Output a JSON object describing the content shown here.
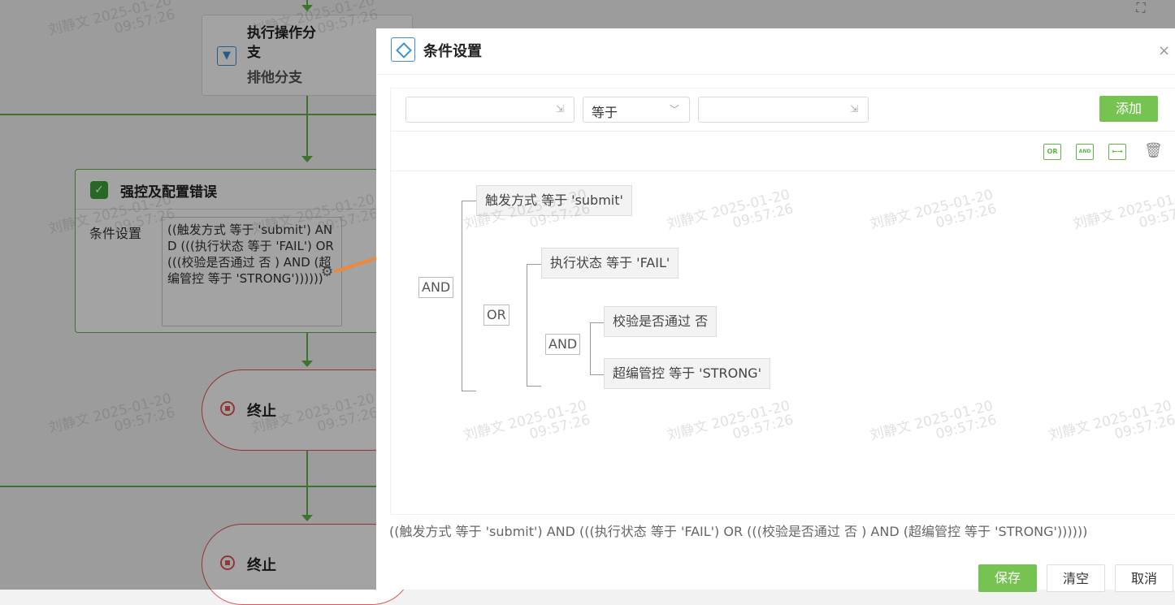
{
  "flow": {
    "branch_node": {
      "title": "执行操作分支",
      "subtitle": "排他分支"
    },
    "condition_node": {
      "title": "强控及配置错误",
      "field_label": "条件设置",
      "condition_text": "((触发方式 等于 'submit') AND (((执行状态 等于 'FAIL') OR (((校验是否通过 否 ) AND (超编管控 等于 'STRONG'))))))"
    },
    "end_nodes": [
      {
        "label": "终止"
      },
      {
        "label": "终止"
      }
    ]
  },
  "watermark": {
    "name": "刘静文",
    "date": "2025-01-20",
    "time": "09:57:26"
  },
  "dialog": {
    "title": "条件设置",
    "close_symbol": "×",
    "toolbar": {
      "left_placeholder": "",
      "operator": "等于",
      "right_placeholder": "",
      "add_label": "添加"
    },
    "tool_icons": [
      {
        "name": "or-icon",
        "label": "OR"
      },
      {
        "name": "and-icon",
        "label": "AND"
      },
      {
        "name": "swap-icon",
        "label": "←→"
      }
    ],
    "tree": {
      "root_op": "AND",
      "level2_op": "OR",
      "level3_op": "AND",
      "leaves": [
        "触发方式 等于 'submit'",
        "执行状态 等于 'FAIL'",
        "校验是否通过 否",
        "超编管控 等于 'STRONG'"
      ]
    },
    "summary": "((触发方式 等于 'submit') AND (((执行状态 等于 'FAIL') OR (((校验是否通过 否 ) AND (超编管控 等于 'STRONG'))))))",
    "buttons": {
      "save": "保存",
      "clear": "清空",
      "cancel": "取消"
    }
  },
  "colors": {
    "accent_green": "#77c351",
    "flow_green": "#63b34a",
    "end_red": "#e05757",
    "icon_blue": "#3c8fd6",
    "arrow_orange": "#f0883a"
  }
}
